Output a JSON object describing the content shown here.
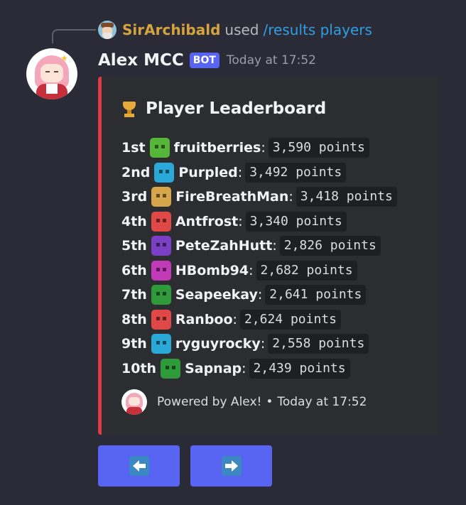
{
  "reply": {
    "username": "SirArchibald",
    "used_text": "used",
    "command": "/results players"
  },
  "message": {
    "author": "Alex MCC",
    "bot_tag": "BOT",
    "timestamp": "Today at 17:52"
  },
  "embed": {
    "accent_color": "#e13c46",
    "title_icon": "trophy-icon",
    "title": "Player Leaderboard",
    "rows": [
      {
        "rank": "1st",
        "icon_color": "#56b63a",
        "name": "fruitberries",
        "points": "3,590 points"
      },
      {
        "rank": "2nd",
        "icon_color": "#2aa8d8",
        "name": "Purpled",
        "points": "3,492 points"
      },
      {
        "rank": "3rd",
        "icon_color": "#d7a54a",
        "name": "FireBreathMan",
        "points": "3,418 points"
      },
      {
        "rank": "4th",
        "icon_color": "#e04848",
        "name": "Antfrost",
        "points": "3,340 points"
      },
      {
        "rank": "5th",
        "icon_color": "#7a3fc4",
        "name": "PeteZahHutt",
        "points": "2,826 points"
      },
      {
        "rank": "6th",
        "icon_color": "#c13ab8",
        "name": "HBomb94",
        "points": "2,682 points"
      },
      {
        "rank": "7th",
        "icon_color": "#2f9a3a",
        "name": "Seapeekay",
        "points": "2,641 points"
      },
      {
        "rank": "8th",
        "icon_color": "#e04848",
        "name": "Ranboo",
        "points": "2,624 points"
      },
      {
        "rank": "9th",
        "icon_color": "#2aa8d8",
        "name": "ryguyrocky",
        "points": "2,558 points"
      },
      {
        "rank": "10th",
        "icon_color": "#2f9a3a",
        "name": "Sapnap",
        "points": "2,439 points"
      }
    ],
    "footer": {
      "text": "Powered by Alex!",
      "separator": "•",
      "timestamp": "Today at 17:52"
    }
  },
  "buttons": {
    "previous_icon": "arrow-left-icon",
    "next_icon": "arrow-right-icon",
    "color": "#5865f2"
  }
}
